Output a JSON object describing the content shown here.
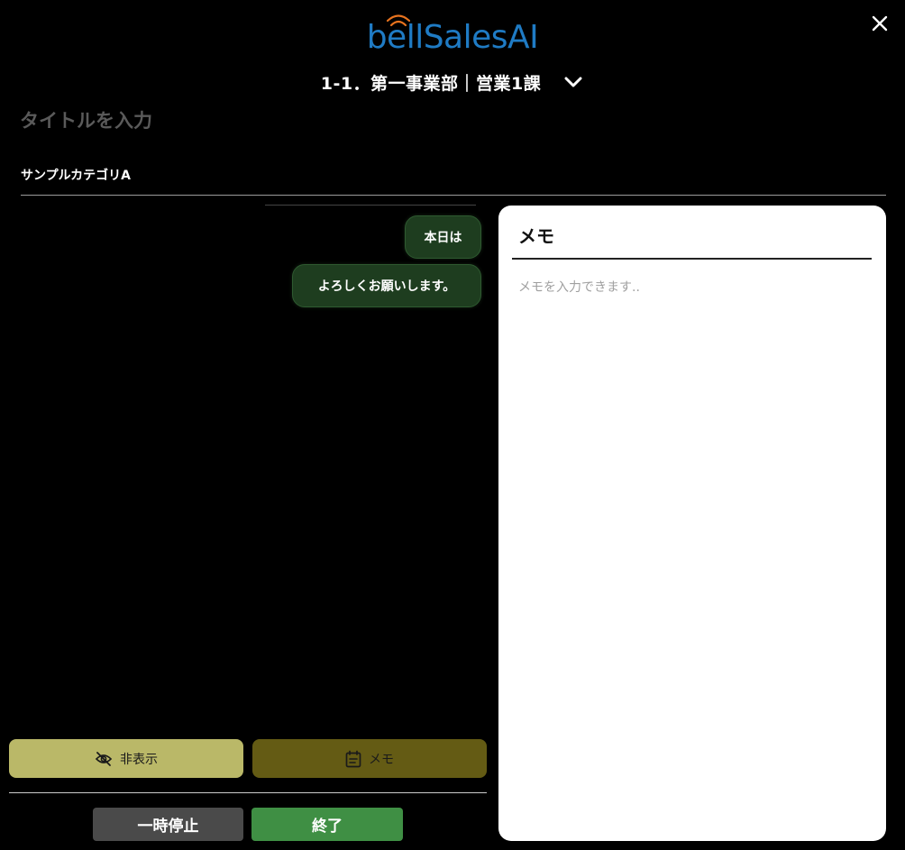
{
  "header": {
    "logo_text": "bellSalesAI",
    "department": "1-1．第一事業部｜営業1課"
  },
  "title": {
    "placeholder": "タイトルを入力",
    "value": ""
  },
  "category": "サンプルカテゴリA",
  "chat": {
    "messages": [
      "本日は",
      "よろしくお願いします。"
    ]
  },
  "controls": {
    "hide_label": "非表示",
    "memo_label": "メモ",
    "pause_label": "一時停止",
    "end_label": "終了"
  },
  "memo": {
    "title": "メモ",
    "placeholder": "メモを入力できます..",
    "value": ""
  },
  "colors": {
    "logo": "#1f7bc4",
    "logo_signal": "#e8731e",
    "bubble": "#1e3d1f",
    "hide_button": "#bab868",
    "memo_button": "#645b14",
    "pause_button": "#4a4a4a",
    "end_button": "#3f8f44"
  }
}
